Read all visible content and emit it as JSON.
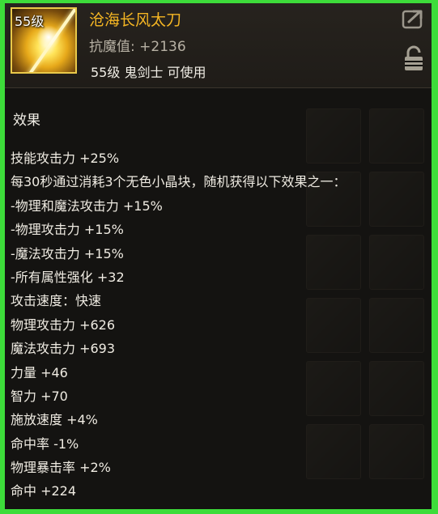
{
  "item": {
    "level_badge": "55级",
    "name": "沧海长风太刀",
    "magic_resist": "抗魔值: +2136",
    "requirement": "55级 鬼剑士 可使用"
  },
  "icons": {
    "share": "share-icon",
    "lock": "lock-icon"
  },
  "colors": {
    "name": "#f5b623",
    "icon_border": "#e9c94a",
    "background": "#141311",
    "outer_border": "#3ddc3a"
  },
  "effects_title": "效果",
  "effects": [
    "技能攻击力 +25%",
    "每30秒通过消耗3个无色小晶块，随机获得以下效果之一：",
    "-物理和魔法攻击力 +15%",
    "-物理攻击力 +15%",
    "-魔法攻击力 +15%",
    "-所有属性强化 +32",
    "攻击速度：快速",
    "物理攻击力 +626",
    "魔法攻击力 +693",
    "力量 +46",
    "智力 +70",
    "施放速度 +4%",
    "命中率 -1%",
    "物理暴击率 +2%",
    "命中 +224"
  ]
}
